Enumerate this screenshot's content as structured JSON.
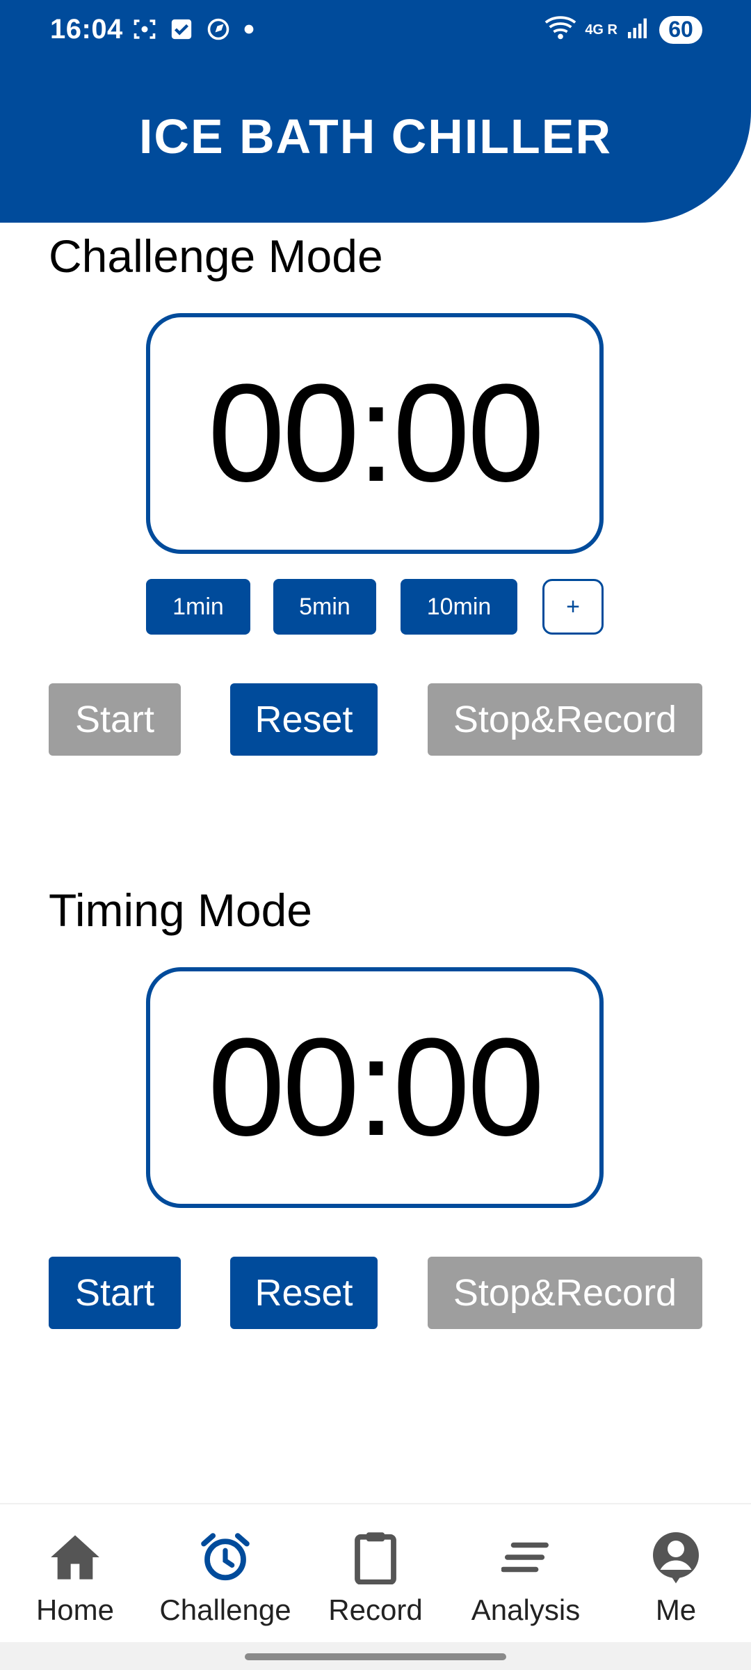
{
  "status_bar": {
    "time": "16:04",
    "network": "4G R",
    "battery": "60"
  },
  "header": {
    "title": "ICE BATH CHILLER"
  },
  "challenge": {
    "title": "Challenge Mode",
    "timer": "00:00",
    "presets": [
      "1min",
      "5min",
      "10min"
    ],
    "add_label": "+",
    "start_label": "Start",
    "reset_label": "Reset",
    "stop_label": "Stop&Record"
  },
  "timing": {
    "title": "Timing Mode",
    "timer": "00:00",
    "start_label": "Start",
    "reset_label": "Reset",
    "stop_label": "Stop&Record"
  },
  "nav": {
    "items": [
      {
        "label": "Home",
        "icon": "home-icon"
      },
      {
        "label": "Challenge",
        "icon": "alarm-clock-icon",
        "active": true
      },
      {
        "label": "Record",
        "icon": "clipboard-icon"
      },
      {
        "label": "Analysis",
        "icon": "analysis-lines-icon"
      },
      {
        "label": "Me",
        "icon": "user-icon"
      }
    ]
  },
  "colors": {
    "primary": "#004b9b",
    "disabled": "#9e9e9e",
    "nav_icon": "#555555"
  }
}
